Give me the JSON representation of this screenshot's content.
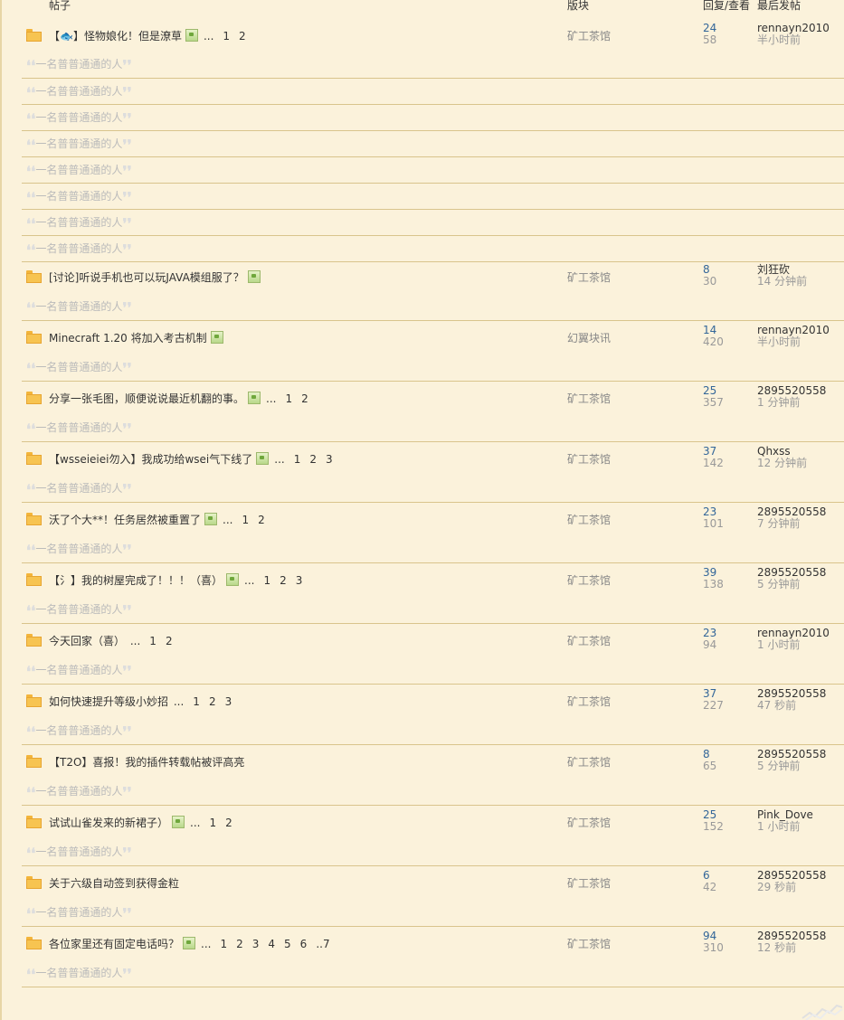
{
  "header": {
    "col_post": "帖子",
    "col_forum": "版块",
    "col_counts": "回复/查看",
    "col_last": "最后发帖"
  },
  "quote_text": "一名普普通通的人",
  "quote_left": "❛❛",
  "quote_right": "❜❜",
  "extra_quotes": [
    "一名普普通通的人",
    "一名普普通通的人",
    "一名普普通通的人",
    "一名普普通通的人",
    "一名普普通通的人",
    "一名普普通通的人",
    "一名普普通通的人"
  ],
  "threads": [
    {
      "title": "【🐟】怪物娘化！但是潦草",
      "has_pic": true,
      "ellipsis": "...",
      "pages": [
        "1",
        "2"
      ],
      "forum": "矿工茶馆",
      "replies": "24",
      "views": "58",
      "last_user": "rennayn2010",
      "last_time": "半小时前"
    },
    {
      "title": "[讨论]听说手机也可以玩JAVA模组服了？",
      "has_pic": true,
      "ellipsis": "",
      "pages": [],
      "forum": "矿工茶馆",
      "replies": "8",
      "views": "30",
      "last_user": "刘狂砍",
      "last_time": "14 分钟前"
    },
    {
      "title": "Minecraft 1.20 将加入考古机制",
      "has_pic": true,
      "ellipsis": "",
      "pages": [],
      "forum": "幻翼块讯",
      "replies": "14",
      "views": "420",
      "last_user": "rennayn2010",
      "last_time": "半小时前"
    },
    {
      "title": "分享一张毛图，顺便说说最近机翻的事。",
      "has_pic": true,
      "ellipsis": "...",
      "pages": [
        "1",
        "2"
      ],
      "forum": "矿工茶馆",
      "replies": "25",
      "views": "357",
      "last_user": "2895520558",
      "last_time": "1 分钟前"
    },
    {
      "title": "【wsseieiei勿入】我成功给wsei气下线了",
      "has_pic": true,
      "ellipsis": "...",
      "pages": [
        "1",
        "2",
        "3"
      ],
      "forum": "矿工茶馆",
      "replies": "37",
      "views": "142",
      "last_user": "Qhxss",
      "last_time": "12 分钟前"
    },
    {
      "title": "沃了个大**！任务居然被重置了",
      "has_pic": true,
      "ellipsis": "...",
      "pages": [
        "1",
        "2"
      ],
      "forum": "矿工茶馆",
      "replies": "23",
      "views": "101",
      "last_user": "2895520558",
      "last_time": "7 分钟前"
    },
    {
      "title": "【氵】我的树屋完成了！！！（喜）",
      "has_pic": true,
      "ellipsis": "...",
      "pages": [
        "1",
        "2",
        "3"
      ],
      "forum": "矿工茶馆",
      "replies": "39",
      "views": "138",
      "last_user": "2895520558",
      "last_time": "5 分钟前"
    },
    {
      "title": "今天回家（喜）",
      "has_pic": false,
      "ellipsis": "...",
      "pages": [
        "1",
        "2"
      ],
      "forum": "矿工茶馆",
      "replies": "23",
      "views": "94",
      "last_user": "rennayn2010",
      "last_time": "1 小时前"
    },
    {
      "title": "如何快速提升等级小妙招",
      "has_pic": false,
      "ellipsis": "...",
      "pages": [
        "1",
        "2",
        "3"
      ],
      "forum": "矿工茶馆",
      "replies": "37",
      "views": "227",
      "last_user": "2895520558",
      "last_time": "47 秒前"
    },
    {
      "title": "【T2O】喜报！我的插件转载帖被评高亮",
      "has_pic": false,
      "ellipsis": "",
      "pages": [],
      "forum": "矿工茶馆",
      "replies": "8",
      "views": "65",
      "last_user": "2895520558",
      "last_time": "5 分钟前"
    },
    {
      "title": "试试山雀发来的新裙子）",
      "has_pic": true,
      "ellipsis": "...",
      "pages": [
        "1",
        "2"
      ],
      "forum": "矿工茶馆",
      "replies": "25",
      "views": "152",
      "last_user": "Pink_Dove",
      "last_time": "1 小时前"
    },
    {
      "title": "关于六级自动签到获得金粒",
      "has_pic": false,
      "ellipsis": "",
      "pages": [],
      "forum": "矿工茶馆",
      "replies": "6",
      "views": "42",
      "last_user": "2895520558",
      "last_time": "29 秒前"
    },
    {
      "title": "各位家里还有固定电话吗？",
      "has_pic": true,
      "ellipsis": "...",
      "pages": [
        "1",
        "2",
        "3",
        "4",
        "5",
        "6",
        "..7"
      ],
      "forum": "矿工茶馆",
      "replies": "94",
      "views": "310",
      "last_user": "2895520558",
      "last_time": "12 秒前"
    }
  ]
}
